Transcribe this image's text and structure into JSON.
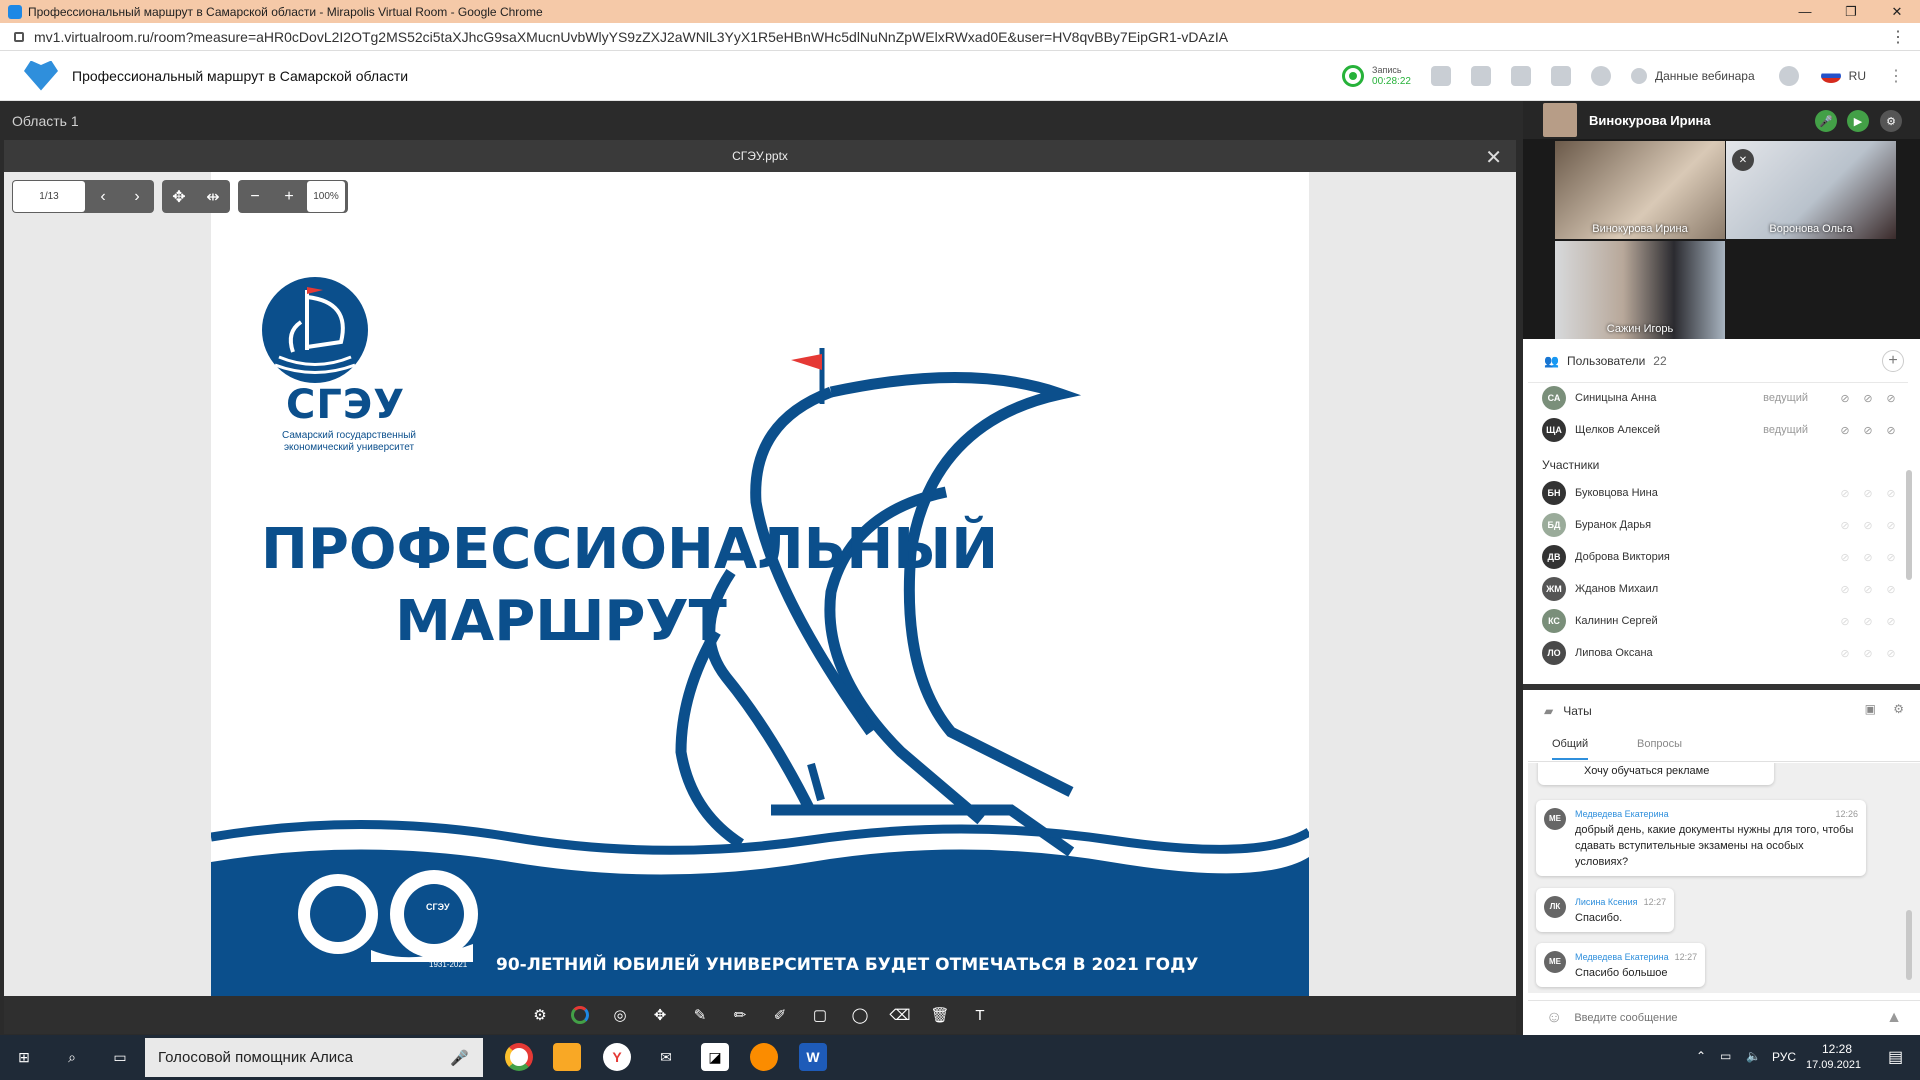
{
  "browser": {
    "window_title": "Профессиональный маршрут в Самарской области - Mirapolis Virtual Room - Google Chrome",
    "url": "mv1.virtualroom.ru/room?measure=aHR0cDovL2I2OTg2MS52ci5taXJhcG9saXMucnUvbWlyYS9zZXJ2aWNlL3YyX1R5eHBnWHc5dlNuNnZpWElxRWxad0E&user=HV8qvBBy7EipGR1-vDAzIA",
    "controls": {
      "minimize": "—",
      "maximize": "❐",
      "close": "✕"
    },
    "menu_icon": "⋮"
  },
  "app": {
    "title": "Профессиональный маршрут в Самарской области",
    "record": {
      "label": "Запись",
      "time": "00:28:22"
    },
    "webinar_data_label": "Данные вебинара",
    "language": "RU",
    "icons": [
      "grid-icon",
      "monitor-icon",
      "document-icon",
      "folder-icon",
      "users-icon",
      "info-icon",
      "settings-icon",
      "flag-ru-icon",
      "menu-icon"
    ]
  },
  "area": {
    "label": "Область 1"
  },
  "presentation": {
    "filename": "СГЭУ.pptx",
    "page": "1/13",
    "zoom": "100%",
    "close_icon": "✕",
    "add_icon": "+"
  },
  "slide": {
    "logo_abbr": "СГЭУ",
    "logo_sub_line1": "Самарский государственный",
    "logo_sub_line2": "экономический университет",
    "headline_line1": "ПРОФЕССИОНАЛЬНЫЙ",
    "headline_line2": "МАРШРУТ",
    "jubilee_number": "90",
    "jubilee_years": "1931-2021",
    "jubilee_badge": "СГЭУ",
    "jubilee_text": "90-ЛЕТНИЙ ЮБИЛЕЙ УНИВЕРСИТЕТА БУДЕТ ОТМЕЧАТЬСЯ В 2021 ГОДУ",
    "brand_color": "#0b4f8c"
  },
  "video": {
    "self_name": "Винокурова Ирина",
    "tiles": [
      {
        "name": "Винокурова Ирина"
      },
      {
        "name": "Воронова Ольга"
      },
      {
        "name": "Сажин Игорь"
      }
    ]
  },
  "users": {
    "title": "Пользователи",
    "count": "22",
    "hosts": [
      {
        "initials": "СА",
        "name": "Синицына Анна",
        "role": "ведущий",
        "color": "#7a8f7a"
      },
      {
        "initials": "ЩА",
        "name": "Щелков Алексей",
        "role": "ведущий",
        "color": "#333333"
      }
    ],
    "participants_title": "Участники",
    "participants": [
      {
        "initials": "БН",
        "name": "Буковцова Нина",
        "color": "#333333"
      },
      {
        "initials": "БД",
        "name": "Буранок Дарья",
        "color": "#9aab9a"
      },
      {
        "initials": "ДВ",
        "name": "Доброва Виктория",
        "color": "#333333"
      },
      {
        "initials": "ЖМ",
        "name": "Жданов Михаил",
        "color": "#555555"
      },
      {
        "initials": "КС",
        "name": "Калинин Сергей",
        "color": "#7a8f7a"
      },
      {
        "initials": "ЛО",
        "name": "Липова Оксана",
        "color": "#4a4a4a"
      }
    ]
  },
  "chats": {
    "title": "Чаты",
    "tabs": [
      "Общий",
      "Вопросы"
    ],
    "active_tab": "Общий",
    "messages": [
      {
        "initials": "",
        "author": "",
        "time": "",
        "text": "Хочу обучаться рекламе"
      },
      {
        "initials": "МЕ",
        "author": "Медведева Екатерина",
        "time": "12:26",
        "text": "добрый день, какие документы нужны для того, чтобы сдавать вступительные экзамены на особых условиях?"
      },
      {
        "initials": "ЛК",
        "author": "Лисина Ксения",
        "time": "12:27",
        "text": "Спасибо."
      },
      {
        "initials": "МЕ",
        "author": "Медведева Екатерина",
        "time": "12:27",
        "text": "Спасибо большое"
      }
    ],
    "input_placeholder": "Введите сообщение"
  },
  "taskbar": {
    "search_text": "Голосовой помощник Алиса",
    "lang": "РУС",
    "time": "12:28",
    "date": "17.09.2021"
  }
}
